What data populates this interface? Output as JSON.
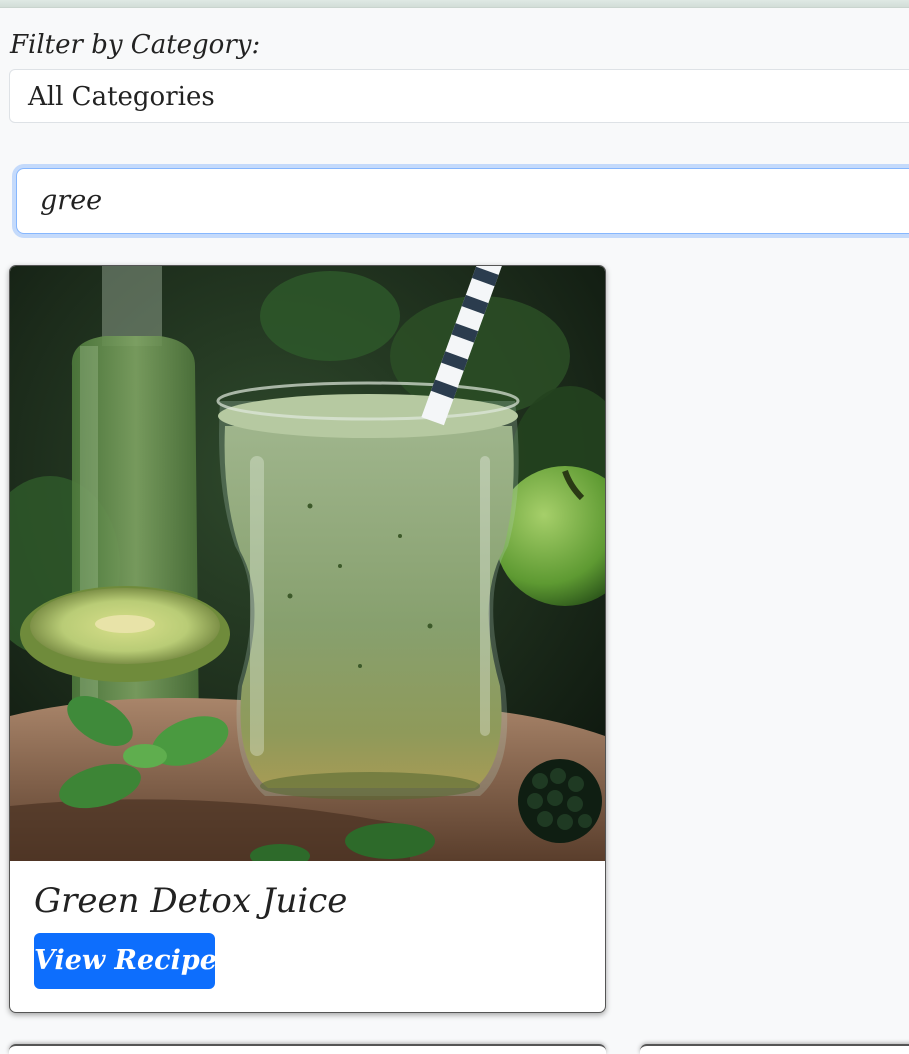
{
  "filter": {
    "label": "Filter by Category:",
    "selected": "All Categories"
  },
  "search": {
    "value": "gree"
  },
  "results": [
    {
      "title": "Green Detox Juice",
      "button_label": "View Recipe"
    }
  ],
  "colors": {
    "accent": "#0d6efd",
    "focus_ring": "#86b7fe",
    "page_bg": "#f8f9fa"
  }
}
